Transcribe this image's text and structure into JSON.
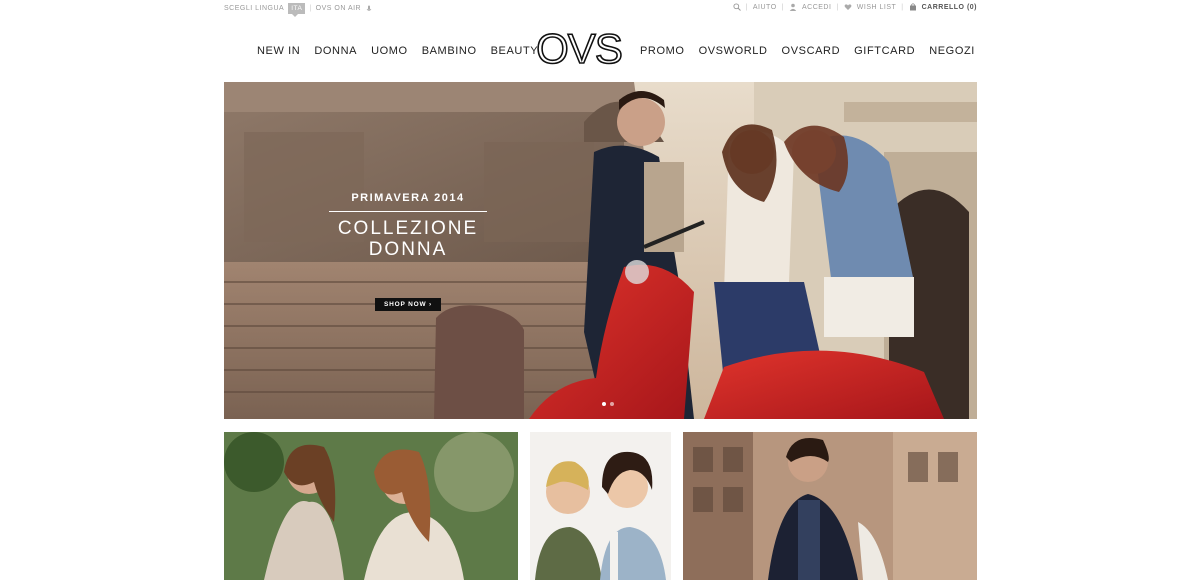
{
  "utility": {
    "language_label": "SCEGLI LINGUA",
    "language_code": "ITA",
    "ovs_on_air": "OVS ON AIR",
    "links": [
      "AIUTO",
      "ACCEDI",
      "WISH LIST"
    ],
    "cart_label": "CARRELLO (0)"
  },
  "nav": {
    "left": [
      "NEW IN",
      "DONNA",
      "UOMO",
      "BAMBINO",
      "BEAUTY"
    ],
    "logo": "OVS",
    "right": [
      "PROMO",
      "OVSWORLD",
      "OVSCARD",
      "GIFTCARD",
      "NEGOZI"
    ]
  },
  "hero": {
    "subtitle": "PRIMAVERA 2014",
    "title_line1": "COLLEZIONE",
    "title_line2": "DONNA",
    "cta": "SHOP NOW ›"
  },
  "colors": {
    "accent": "#111111",
    "hero_bg": "#b89a82",
    "vespa_red": "#c8201c"
  }
}
